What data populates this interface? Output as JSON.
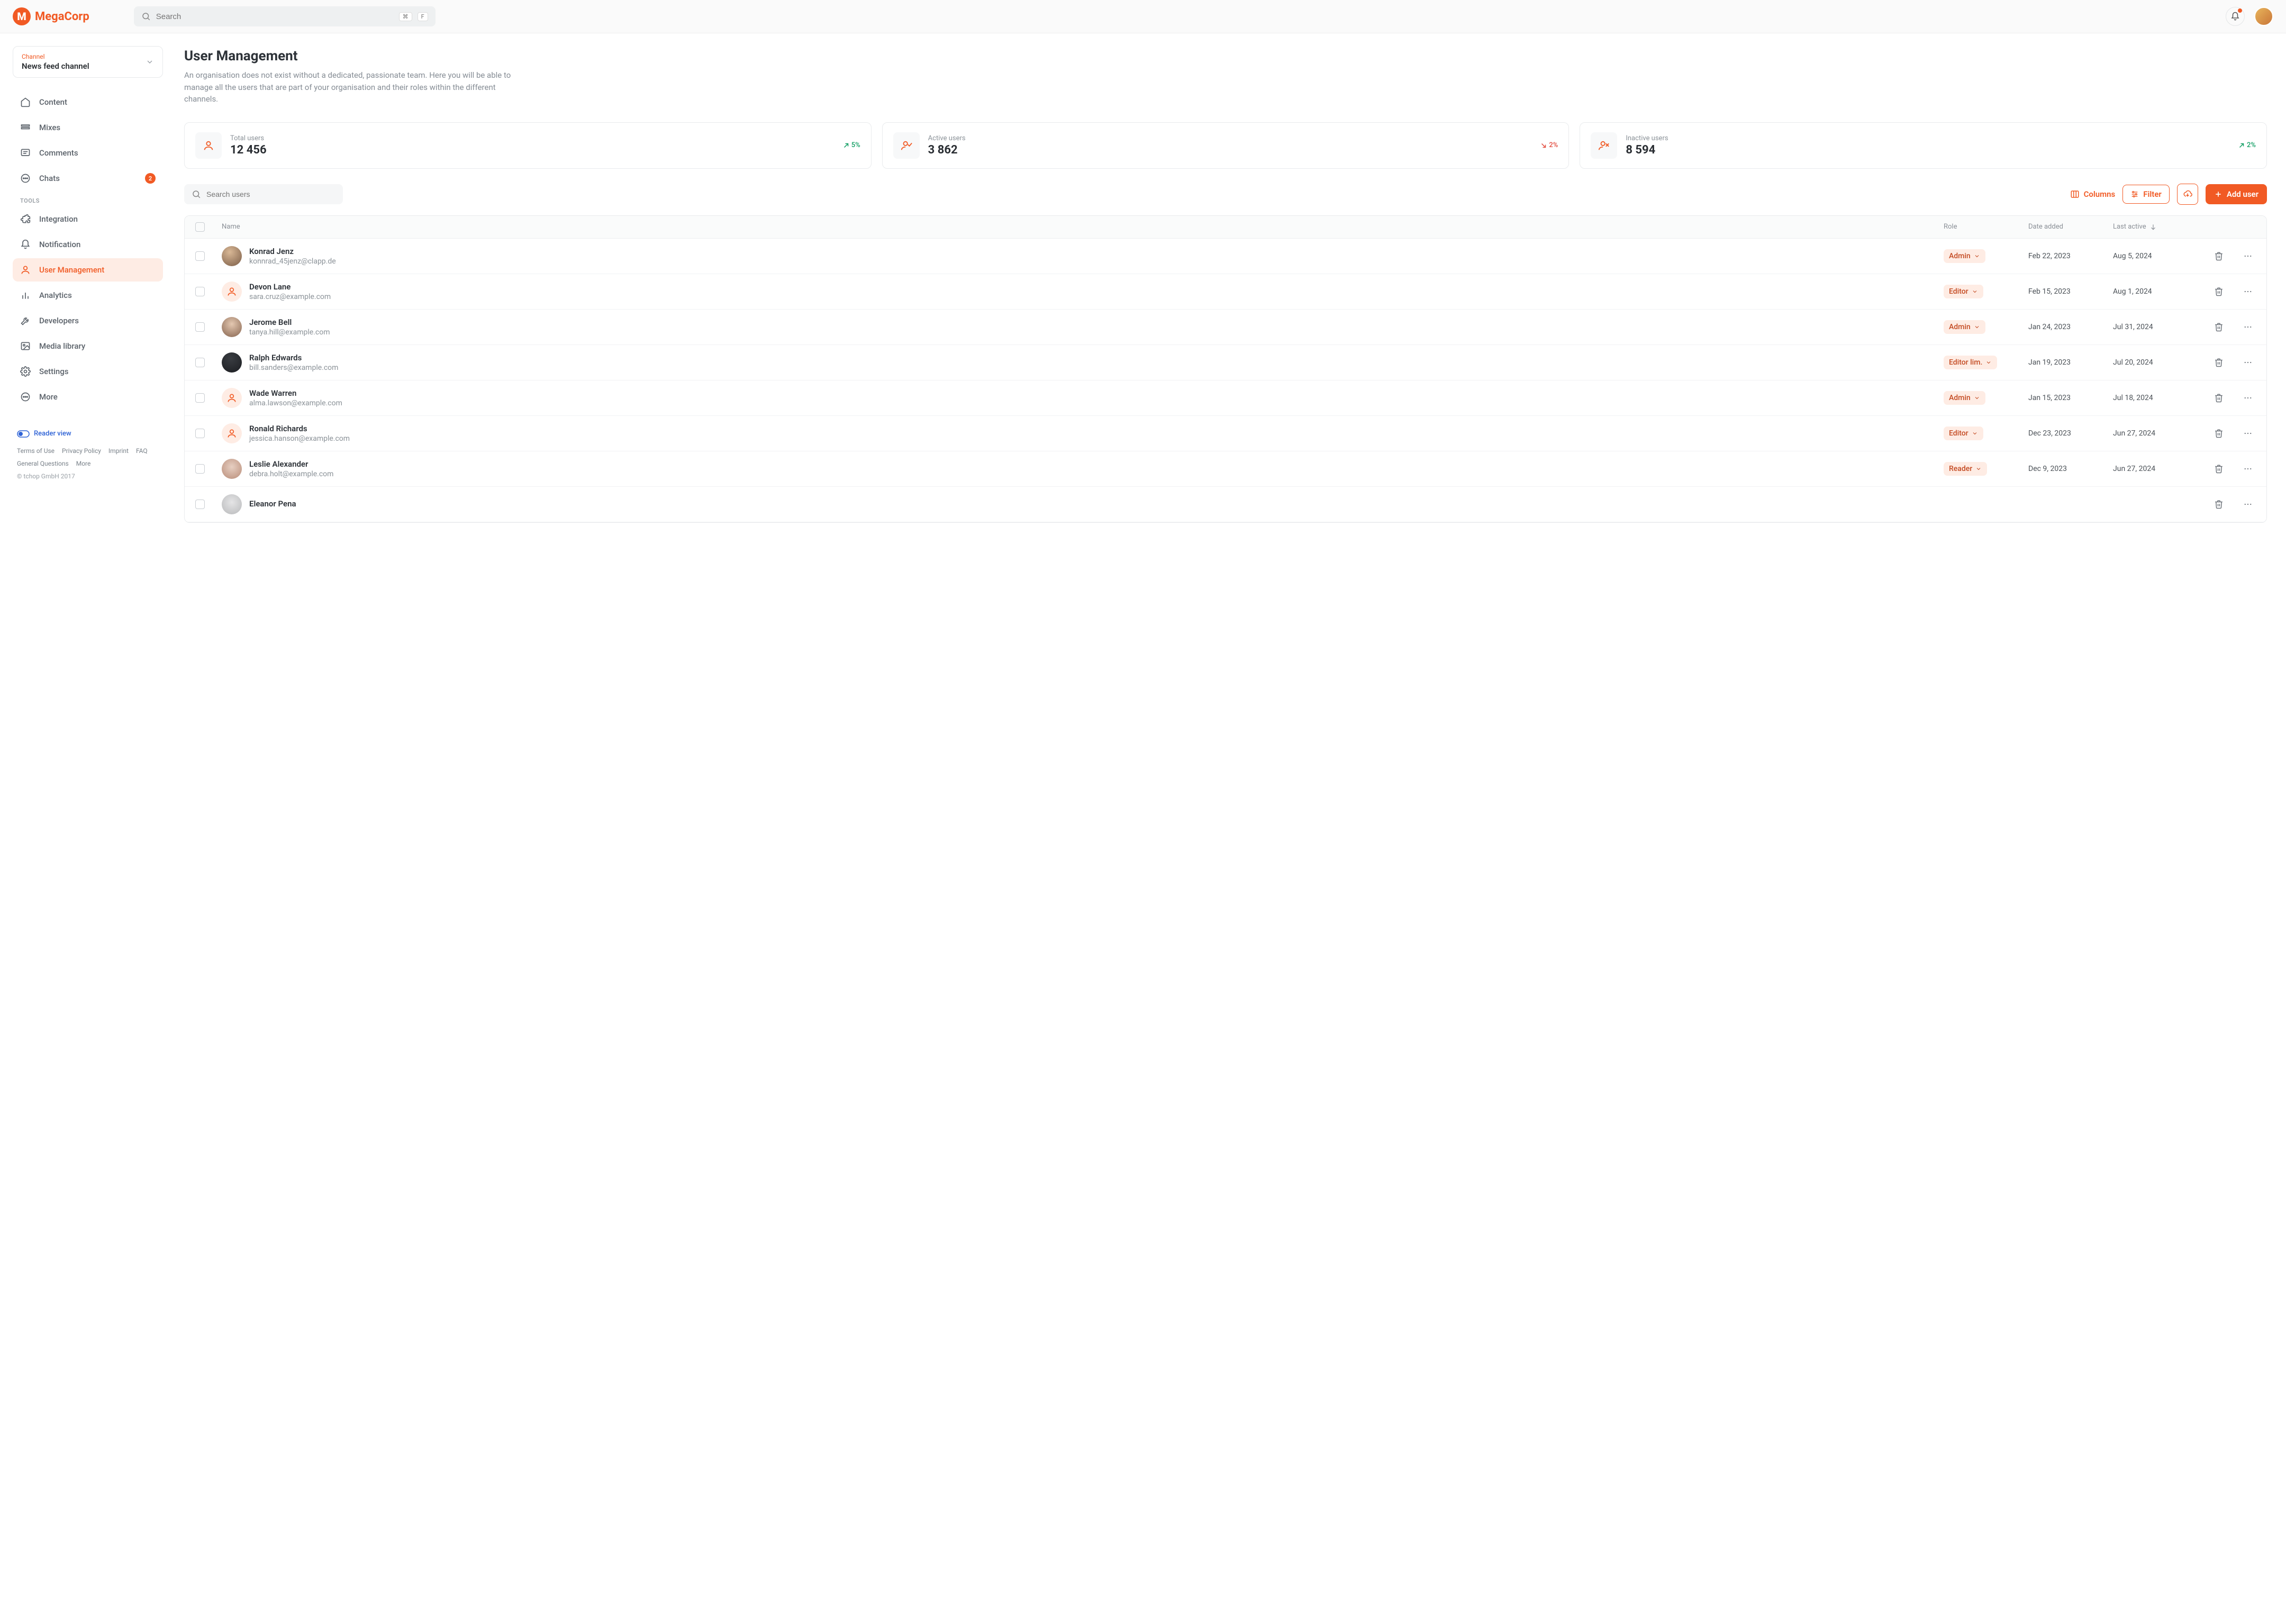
{
  "brand": {
    "name": "MegaCorp",
    "mark": "M"
  },
  "search": {
    "placeholder": "Search",
    "kbd_cmd": "⌘",
    "kbd_key": "F"
  },
  "channel": {
    "label": "Channel",
    "value": "News feed channel"
  },
  "sidebar": {
    "items": [
      {
        "label": "Content",
        "icon": "home"
      },
      {
        "label": "Mixes",
        "icon": "mixes"
      },
      {
        "label": "Comments",
        "icon": "comments"
      },
      {
        "label": "Chats",
        "icon": "chats",
        "badge": "2"
      }
    ],
    "tools_heading": "TOOLS",
    "tools": [
      {
        "label": "Integration",
        "icon": "puzzle"
      },
      {
        "label": "Notification",
        "icon": "bell"
      },
      {
        "label": "User Management",
        "icon": "user",
        "active": true
      },
      {
        "label": "Analytics",
        "icon": "analytics"
      },
      {
        "label": "Developers",
        "icon": "wrench"
      },
      {
        "label": "Media library",
        "icon": "media"
      },
      {
        "label": "Settings",
        "icon": "gear"
      },
      {
        "label": "More",
        "icon": "more"
      }
    ]
  },
  "bottom": {
    "reader": "Reader view",
    "links": [
      "Terms of Use",
      "Privacy Policy",
      "Imprint",
      "FAQ",
      "General Questions",
      "More"
    ],
    "copyright": "© tchop GmbH 2017"
  },
  "page": {
    "title": "User Management",
    "description": "An organisation does not exist without a dedicated, passionate team. Here you will be able to manage all the users that are part of your organisation and their roles within the different channels."
  },
  "stats": [
    {
      "label": "Total users",
      "value": "12 456",
      "trend": "5%",
      "dir": "up",
      "icon": "user"
    },
    {
      "label": "Active users",
      "value": "3 862",
      "trend": "2%",
      "dir": "down",
      "icon": "user-check"
    },
    {
      "label": "Inactive users",
      "value": "8 594",
      "trend": "2%",
      "dir": "up",
      "icon": "user-x"
    }
  ],
  "toolbar": {
    "search_placeholder": "Search users",
    "columns": "Columns",
    "filter": "Filter",
    "add": "Add user"
  },
  "table": {
    "headers": {
      "name": "Name",
      "role": "Role",
      "added": "Date added",
      "active": "Last active"
    },
    "rows": [
      {
        "name": "Konrad Jenz",
        "email": "konnrad_45jenz@clapp.de",
        "role": "Admin",
        "added": "Feb 22, 2023",
        "active": "Aug 5, 2024",
        "avatar": "photo1"
      },
      {
        "name": "Devon Lane",
        "email": "sara.cruz@example.com",
        "role": "Editor",
        "added": "Feb 15, 2023",
        "active": "Aug 1, 2024",
        "avatar": "ph"
      },
      {
        "name": "Jerome Bell",
        "email": "tanya.hill@example.com",
        "role": "Admin",
        "added": "Jan 24, 2023",
        "active": "Jul 31, 2024",
        "avatar": "photo2"
      },
      {
        "name": "Ralph Edwards",
        "email": "bill.sanders@example.com",
        "role": "Editor lim.",
        "added": "Jan 19, 2023",
        "active": "Jul 20, 2024",
        "avatar": "photo3"
      },
      {
        "name": "Wade Warren",
        "email": "alma.lawson@example.com",
        "role": "Admin",
        "added": "Jan 15, 2023",
        "active": "Jul 18, 2024",
        "avatar": "ph"
      },
      {
        "name": "Ronald Richards",
        "email": "jessica.hanson@example.com",
        "role": "Editor",
        "added": "Dec 23, 2023",
        "active": "Jun 27, 2024",
        "avatar": "ph"
      },
      {
        "name": "Leslie Alexander",
        "email": "debra.holt@example.com",
        "role": "Reader",
        "added": "Dec 9, 2023",
        "active": "Jun 27, 2024",
        "avatar": "photo4"
      },
      {
        "name": "Eleanor Pena",
        "email": "",
        "role": "",
        "added": "",
        "active": "",
        "avatar": "photo5"
      }
    ]
  }
}
